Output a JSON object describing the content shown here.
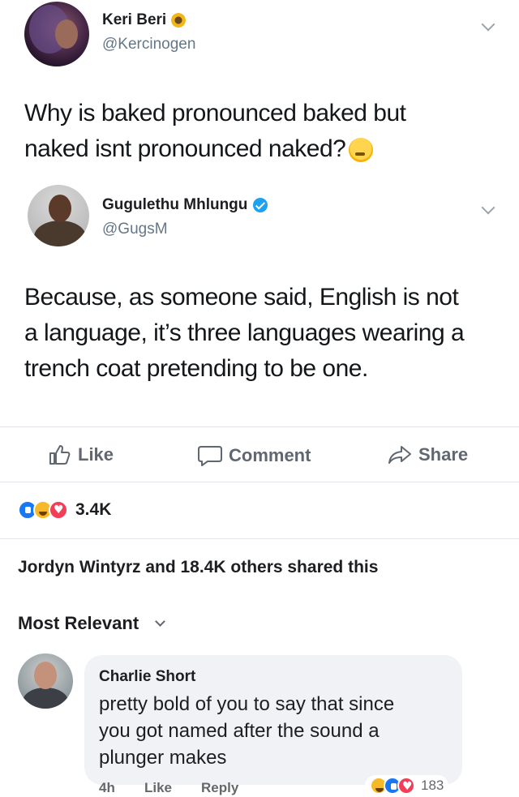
{
  "tweet1": {
    "name": "Keri Beri",
    "handle": "@Kercinogen",
    "text_line1": "Why is baked pronounced baked but",
    "text_line2": "naked isnt pronounced naked?"
  },
  "tweet2": {
    "name": "Gugulethu Mhlungu",
    "handle": "@GugsM",
    "text_line1": "Because, as someone said, English is not",
    "text_line2": "a language, it’s three languages wearing a",
    "text_line3": "trench coat pretending to be one."
  },
  "actions": {
    "like": "Like",
    "comment": "Comment",
    "share": "Share"
  },
  "reactions": {
    "icons": [
      "like-icon",
      "haha-icon",
      "love-icon"
    ],
    "count": "3.4K"
  },
  "shared_text": "Jordyn Wintyrz and 18.4K others shared this",
  "sort_label": "Most Relevant",
  "comment": {
    "name": "Charlie Short",
    "line1": "pretty bold of you to say that since",
    "line2": "you got named after the sound a",
    "line3": "plunger makes",
    "time": "4h",
    "like_label": "Like",
    "reply_label": "Reply",
    "reaction_count": "183"
  },
  "colors": {
    "brand_blue": "#1877f2",
    "verified_blue": "#1da1f2",
    "muted_text": "#606770"
  }
}
